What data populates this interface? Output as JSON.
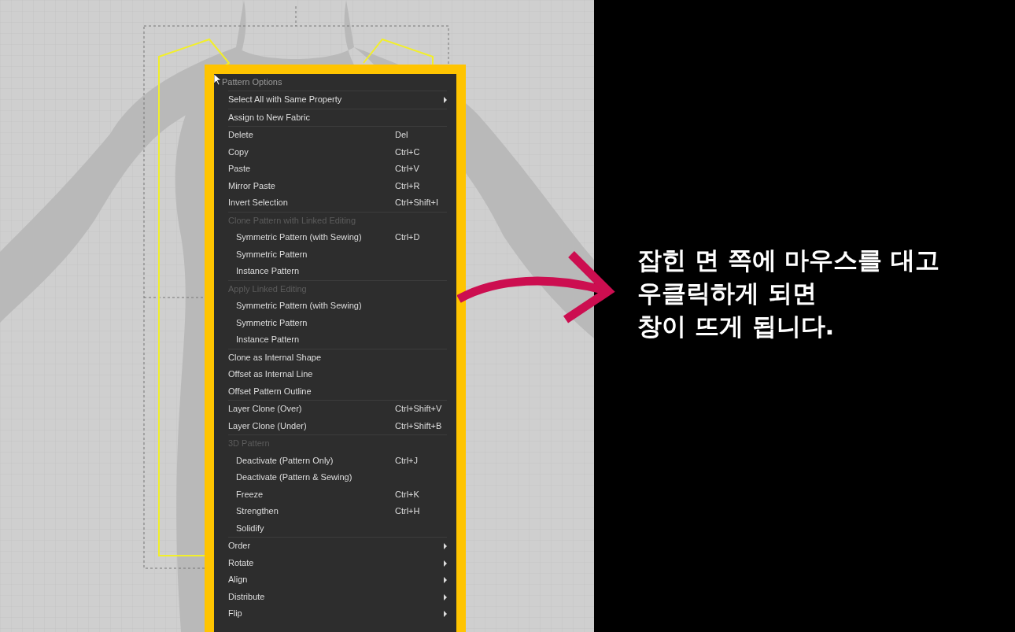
{
  "menu": {
    "title": "Pattern Options",
    "groups": [
      {
        "items": [
          {
            "label": "Select All with Same Property",
            "submenu": true
          }
        ]
      },
      {
        "items": [
          {
            "label": "Assign to New Fabric",
            "submenu": false
          }
        ]
      },
      {
        "items": [
          {
            "label": "Delete",
            "shortcut": "Del",
            "submenu": false
          },
          {
            "label": "Copy",
            "shortcut": "Ctrl+C",
            "submenu": false
          },
          {
            "label": "Paste",
            "shortcut": "Ctrl+V",
            "submenu": false
          },
          {
            "label": "Mirror Paste",
            "shortcut": "Ctrl+R",
            "submenu": false
          },
          {
            "label": "Invert Selection",
            "shortcut": "Ctrl+Shift+I",
            "submenu": false
          }
        ]
      },
      {
        "heading": "Clone Pattern with Linked Editing",
        "items": [
          {
            "label": "Symmetric Pattern (with Sewing)",
            "shortcut": "Ctrl+D",
            "submenu": false
          },
          {
            "label": "Symmetric Pattern",
            "submenu": false
          },
          {
            "label": "Instance Pattern",
            "submenu": false
          }
        ]
      },
      {
        "heading": "Apply Linked Editing",
        "items": [
          {
            "label": "Symmetric Pattern (with Sewing)",
            "submenu": false
          },
          {
            "label": "Symmetric Pattern",
            "submenu": false
          },
          {
            "label": "Instance Pattern",
            "submenu": false
          }
        ]
      },
      {
        "items": [
          {
            "label": "Clone as Internal Shape",
            "submenu": false
          },
          {
            "label": "Offset as Internal Line",
            "submenu": false
          },
          {
            "label": "Offset Pattern Outline",
            "submenu": false
          }
        ]
      },
      {
        "items": [
          {
            "label": "Layer Clone (Over)",
            "shortcut": "Ctrl+Shift+V",
            "submenu": false
          },
          {
            "label": "Layer Clone (Under)",
            "shortcut": "Ctrl+Shift+B",
            "submenu": false
          }
        ]
      },
      {
        "heading": "3D Pattern",
        "items": [
          {
            "label": "Deactivate (Pattern Only)",
            "shortcut": "Ctrl+J",
            "submenu": false
          },
          {
            "label": "Deactivate (Pattern & Sewing)",
            "submenu": false
          },
          {
            "label": "Freeze",
            "shortcut": "Ctrl+K",
            "submenu": false
          },
          {
            "label": "Strengthen",
            "shortcut": "Ctrl+H",
            "submenu": false
          },
          {
            "label": "Solidify",
            "submenu": false
          }
        ]
      },
      {
        "items": [
          {
            "label": "Order",
            "submenu": true
          },
          {
            "label": "Rotate",
            "submenu": true
          },
          {
            "label": "Align",
            "submenu": true
          },
          {
            "label": "Distribute",
            "submenu": true
          },
          {
            "label": "Flip",
            "submenu": true
          }
        ]
      }
    ]
  },
  "caption_lines": [
    "잡힌 면 쪽에 마우스를 대고",
    "우클릭하게 되면",
    "창이 뜨게 됩니다."
  ]
}
